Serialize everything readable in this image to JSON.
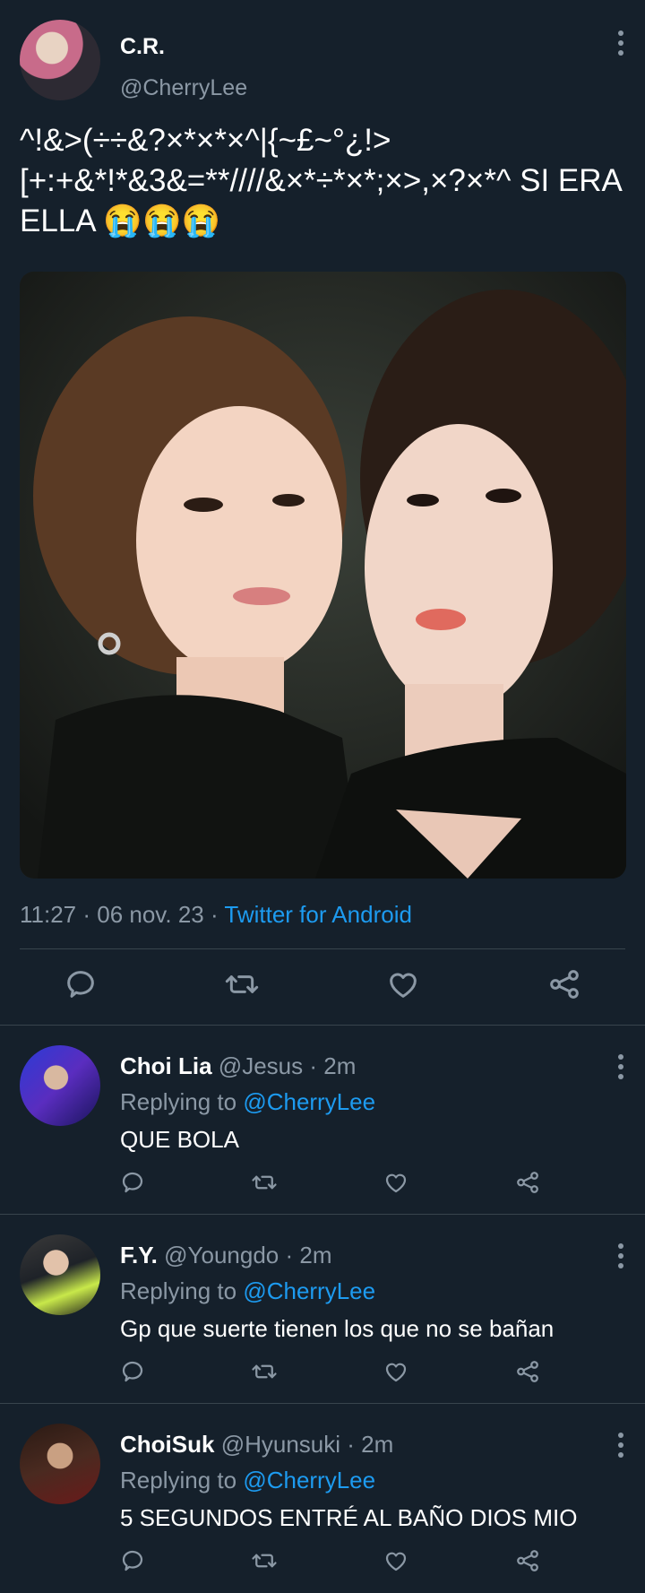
{
  "tweet": {
    "author_name": "C.R.",
    "author_handle": "@CherryLee",
    "text": "^!&>(÷÷&?×*×*×^|{~£~°¿!>[+:+&*!*&3&=**////&×*÷*×*;×>,×?×*^ SI ERA ELLA 😭😭😭",
    "time": "11:27 · 06 nov. 23 · ",
    "client": "Twitter for Android",
    "photo_icon": "photo-of-two-women"
  },
  "icons": {
    "reply": "reply-icon",
    "retweet": "retweet-icon",
    "like": "like-icon",
    "share": "share-icon",
    "more": "more-options-icon"
  },
  "colors": {
    "background": "#15202b",
    "muted": "#8b98a5",
    "accent": "#1d9bf0",
    "divider": "#38444d"
  },
  "replies": [
    {
      "name": "Choi Lia",
      "handle": "@Jesus",
      "time": " · 2m",
      "replying_prefix": "Replying to ",
      "replying_to": "@CherryLee",
      "text": "QUE BOLA"
    },
    {
      "name": "F.Y.",
      "handle": "@Youngdo",
      "time": " · 2m",
      "replying_prefix": "Replying to ",
      "replying_to": "@CherryLee",
      "text": "Gp que suerte tienen los que no se bañan"
    },
    {
      "name": "ChoiSuk",
      "handle": "@Hyunsuki",
      "time": " · 2m",
      "replying_prefix": "Replying to ",
      "replying_to": "@CherryLee",
      "text": "5 SEGUNDOS ENTRÉ AL BAÑO DIOS MIO"
    }
  ]
}
